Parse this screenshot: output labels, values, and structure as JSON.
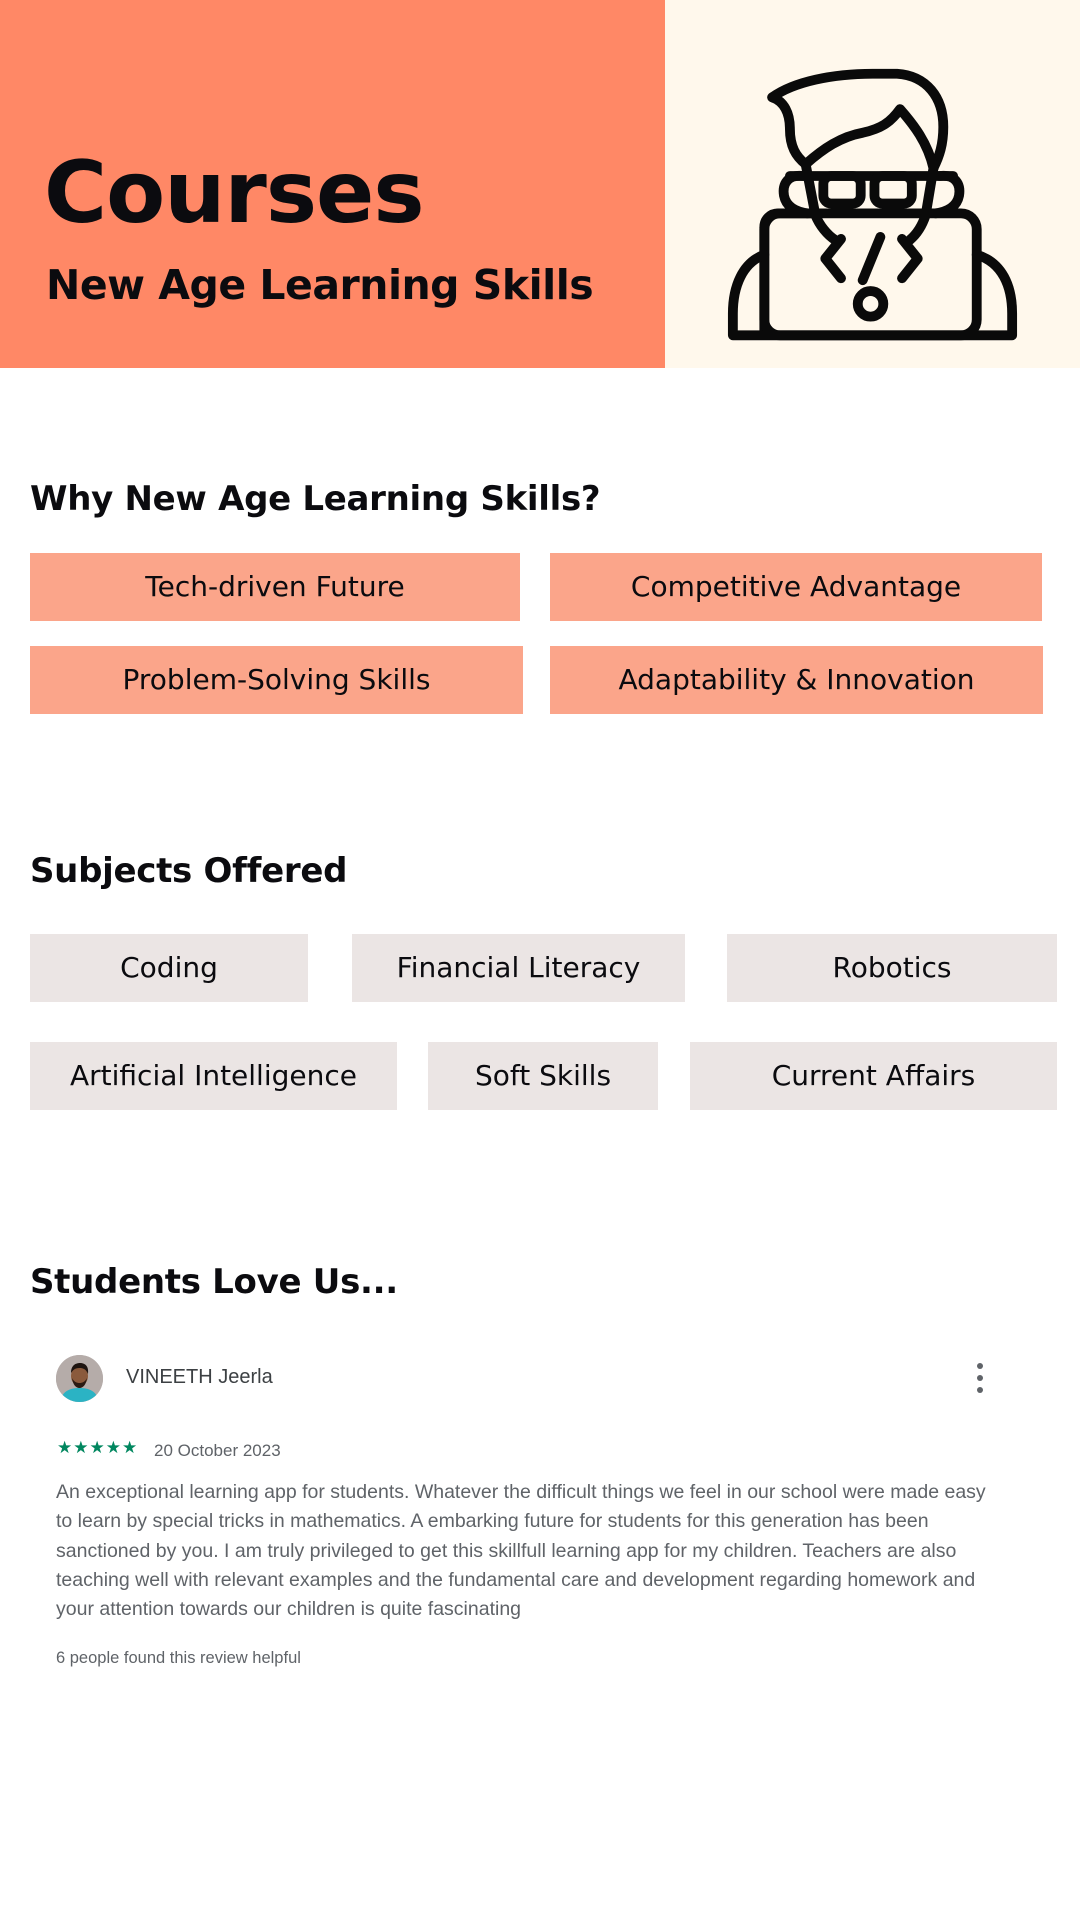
{
  "hero": {
    "title": "Courses",
    "subtitle": "New Age Learning Skills",
    "icon": "coder-avatar-icon",
    "colors": {
      "left_bg": "#ff8866",
      "right_bg": "#fff8ec"
    }
  },
  "why": {
    "title": "Why New Age Learning Skills?",
    "items": [
      {
        "label": "Tech-driven Future"
      },
      {
        "label": "Competitive Advantage"
      },
      {
        "label": "Problem-Solving Skills"
      },
      {
        "label": "Adaptability & Innovation"
      }
    ],
    "pill_color": "#fba58a"
  },
  "subjects": {
    "title": "Subjects Offered",
    "items": [
      {
        "label": "Coding"
      },
      {
        "label": "Financial Literacy"
      },
      {
        "label": "Robotics"
      },
      {
        "label": "Artificial Intelligence"
      },
      {
        "label": "Soft Skills"
      },
      {
        "label": "Current Affairs"
      }
    ],
    "pill_color": "#ebe5e4"
  },
  "testimonials": {
    "title": "Students Love Us...",
    "review": {
      "author": "VINEETH Jeerla",
      "rating": 5,
      "rating_max": 5,
      "stars": "★★★★★",
      "date": "20 October 2023",
      "text": "An exceptional learning app for students. Whatever the difficult things we feel in our school were made easy to learn by special tricks in mathematics. A embarking future for students for this generation has been sanctioned by you. I am truly privileged to get this skillfull learning app for my children. Teachers are also teaching well with relevant examples and the fundamental care and development regarding homework and your attention towards our children is quite fascinating",
      "helpful": "6 people found this review helpful",
      "star_color": "#01875f",
      "menu_icon": "more-vert-icon"
    }
  }
}
